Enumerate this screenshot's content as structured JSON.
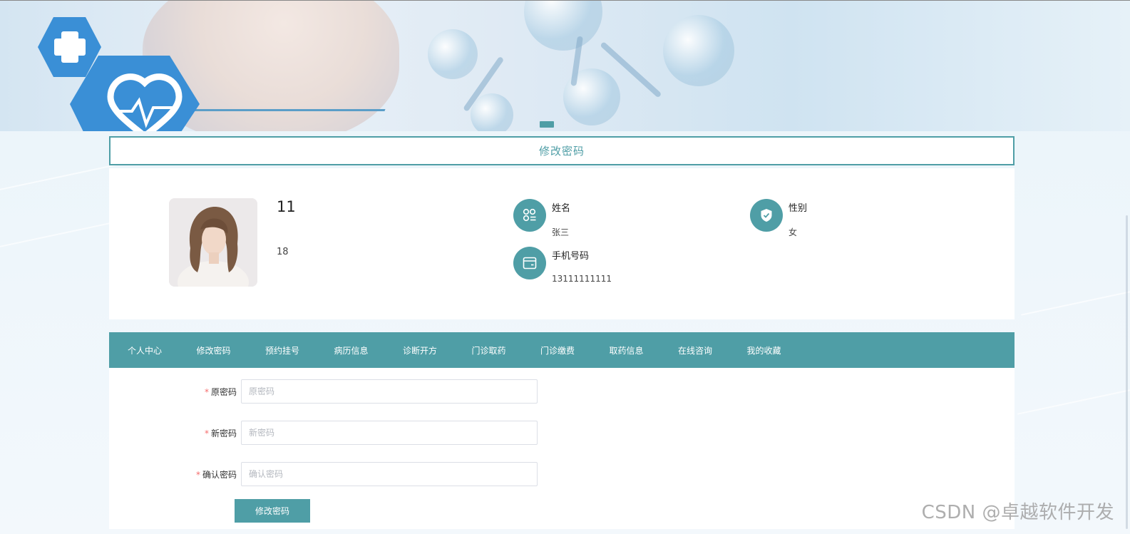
{
  "page_title": "修改密码",
  "profile": {
    "username": "11",
    "age": "18",
    "fields": [
      {
        "label": "姓名",
        "value": "张三",
        "icon": "apps-icon"
      },
      {
        "label": "性别",
        "value": "女",
        "icon": "shield-check-icon"
      },
      {
        "label": "手机号码",
        "value": "13111111111",
        "icon": "wallet-icon"
      }
    ]
  },
  "nav": {
    "items": [
      "个人中心",
      "修改密码",
      "预约挂号",
      "病历信息",
      "诊断开方",
      "门诊取药",
      "门诊缴费",
      "取药信息",
      "在线咨询",
      "我的收藏"
    ],
    "active_index": 1
  },
  "form": {
    "old_password": {
      "label": "原密码",
      "placeholder": "原密码",
      "value": ""
    },
    "new_password": {
      "label": "新密码",
      "placeholder": "新密码",
      "value": ""
    },
    "confirm_password": {
      "label": "确认密码",
      "placeholder": "确认密码",
      "value": ""
    },
    "required_mark": "*",
    "submit_label": "修改密码"
  },
  "watermark": "CSDN @卓越软件开发",
  "colors": {
    "accent": "#4f9ea6",
    "required": "#f56c6c"
  }
}
